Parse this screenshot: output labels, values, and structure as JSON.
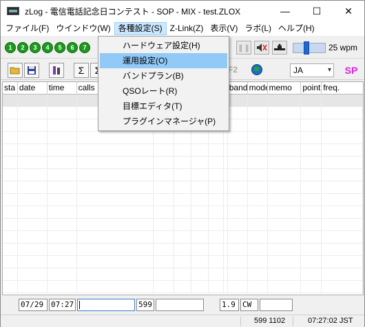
{
  "window": {
    "title": "zLog - 電信電話記念日コンテスト - SOP - MIX - test.ZLOX",
    "minimize": "—",
    "maximize": "☐",
    "close": "✕"
  },
  "menu": [
    {
      "label": "ファイル(F)"
    },
    {
      "label": "ウインドウ(W)"
    },
    {
      "label": "各種設定(S)"
    },
    {
      "label": "Z-Link(Z)"
    },
    {
      "label": "表示(V)"
    },
    {
      "label": "ラボ(L)"
    },
    {
      "label": "ヘルプ(H)"
    }
  ],
  "dropdown": {
    "items": [
      {
        "label": "ハードウェア設定(H)"
      },
      {
        "label": "運用設定(O)"
      },
      {
        "label": "バンドプラン(B)"
      },
      {
        "label": "QSOレート(R)"
      },
      {
        "label": "目標エディタ(T)"
      },
      {
        "label": "プラグインマネージャ(P)"
      }
    ]
  },
  "toolbar1": {
    "leds": [
      "1",
      "2",
      "3",
      "4",
      "5",
      "6",
      "7"
    ],
    "speed": "25 wpm",
    "speed_level": 0.4
  },
  "toolbar2": {
    "sigma1": "Σ",
    "sigma2": "Σ",
    "f2": "F2",
    "country": "JA",
    "mode_badge": "SP"
  },
  "grid": {
    "columns": [
      "sta",
      "date",
      "time",
      "calls",
      "",
      "",
      "",
      "",
      "",
      "band",
      "mode",
      "memo",
      "point",
      "freq."
    ]
  },
  "entry": {
    "date": "07/29",
    "time": "07:27",
    "callsign": "",
    "rst": "599",
    "number": "",
    "band": "1.9",
    "mode": "CW",
    "extra": ""
  },
  "status": {
    "sent": "599 1102",
    "clock": "07:27:02 JST"
  },
  "colors": {
    "led_green": "#1c9a1c",
    "menu_highlight": "#91c9f7",
    "sp_color": "#e020e0"
  }
}
